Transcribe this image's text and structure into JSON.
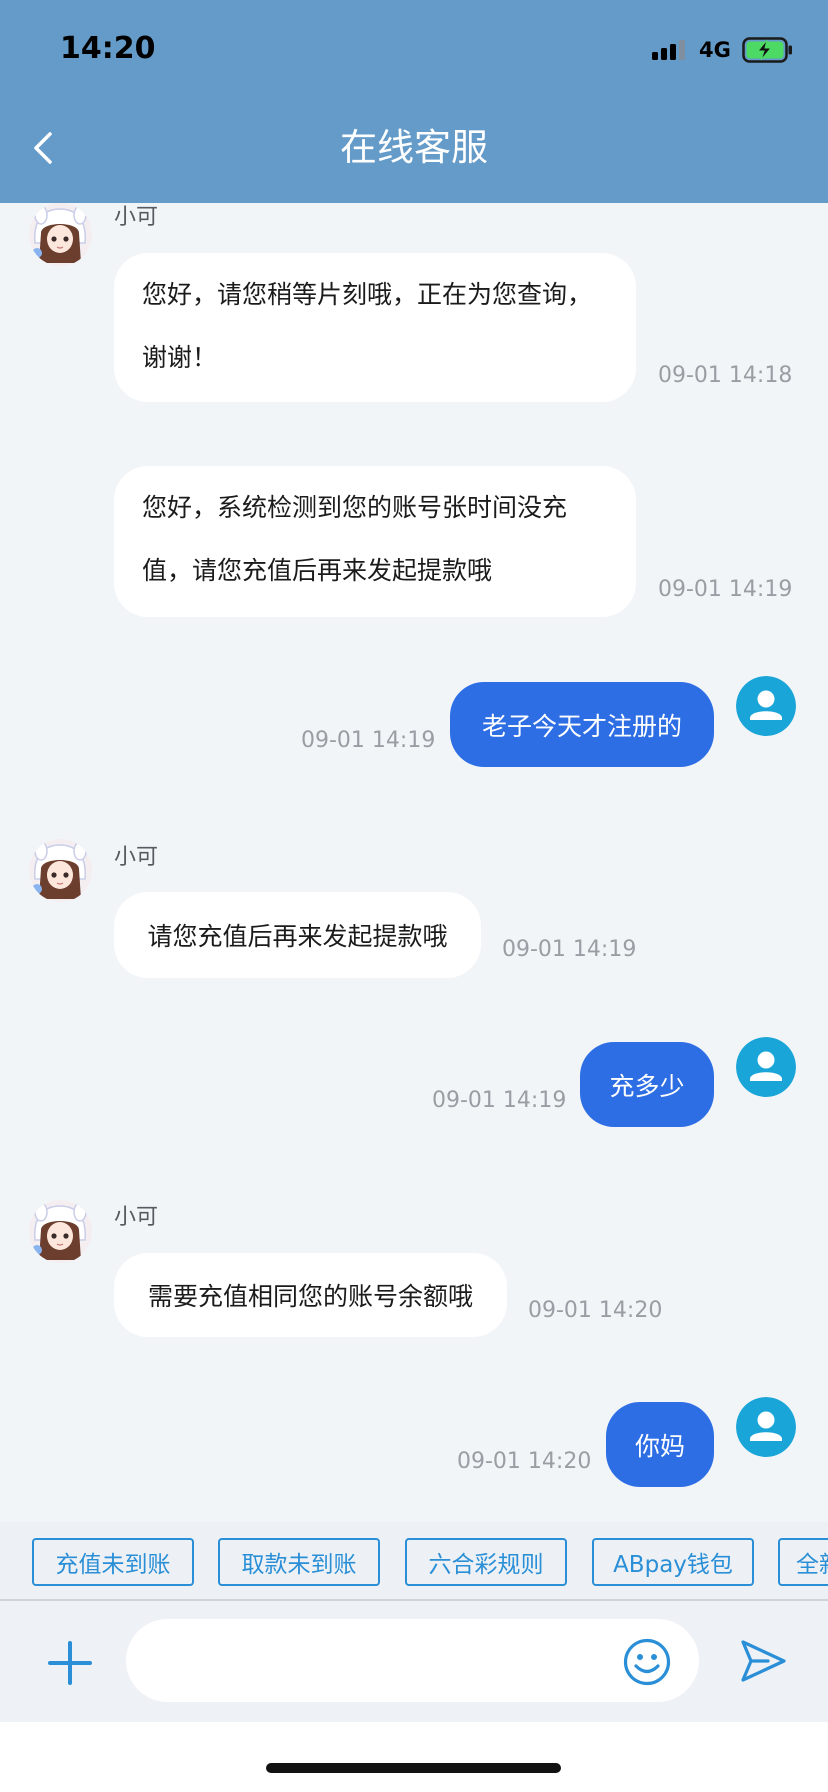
{
  "status_bar": {
    "time": "14:20",
    "network": "4G",
    "signal_icon": "signal-bars-icon",
    "battery_icon": "battery-charging-icon"
  },
  "header": {
    "title": "在线客服",
    "back_icon": "chevron-left-icon"
  },
  "messages": [
    {
      "name": "小可",
      "lines": [
        "您好，请您稍等片刻哦，正在为您查询，",
        "谢谢！"
      ],
      "time": "09-01 14:18"
    },
    {
      "lines": [
        "您好，系统检测到您的账号张时间没充",
        "值，请您充值后再来发起提款哦"
      ],
      "time": "09-01 14:19"
    },
    {
      "lines": [
        "老子今天才注册的"
      ],
      "time": "09-01 14:19"
    },
    {
      "name": "小可",
      "lines": [
        "请您充值后再来发起提款哦"
      ],
      "time": "09-01 14:19"
    },
    {
      "lines": [
        "充多少"
      ],
      "time": "09-01 14:19"
    },
    {
      "name": "小可",
      "lines": [
        "需要充值相同您的账号余额哦"
      ],
      "time": "09-01 14:20"
    },
    {
      "lines": [
        "你妈"
      ],
      "time": "09-01 14:20"
    }
  ],
  "quick_replies": [
    "充值未到账",
    "取款未到账",
    "六合彩规则",
    "ABpay钱包",
    "全新"
  ],
  "input_bar": {
    "add_icon": "plus-icon",
    "emoji_icon": "emoji-icon",
    "send_icon": "send-icon"
  },
  "colors": {
    "header": "#659bc8",
    "chat_background": "#f2f5f8",
    "agent_bubble": "#ffffff",
    "user_bubble": "#2d6ee5",
    "user_avatar": "#1aa5d9",
    "accent": "#2a8fd6",
    "time_text": "#9a9ea4",
    "battery": "#4cd964"
  }
}
